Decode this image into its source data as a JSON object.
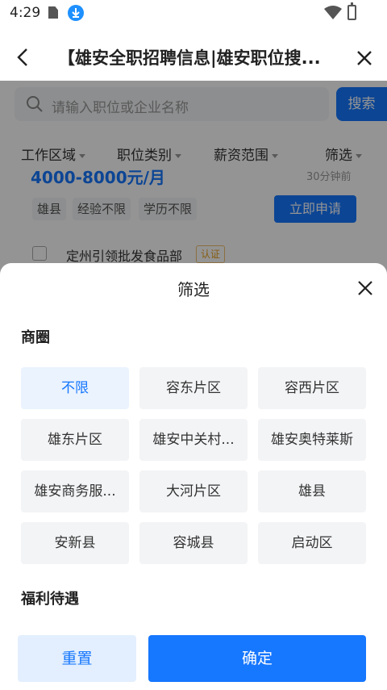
{
  "status_bar": {
    "time": "4:29"
  },
  "title_bar": {
    "title": "【雄安全职招聘信息|雄安职位搜..."
  },
  "background_page": {
    "search": {
      "placeholder": "请输入职位或企业名称",
      "button": "搜索"
    },
    "filters": [
      "工作区域",
      "职位类别",
      "薪资范围",
      "筛选"
    ],
    "job": {
      "salary": "4000-8000元/月",
      "posted": "30分钟前",
      "tags": [
        "雄县",
        "经验不限",
        "学历不限"
      ],
      "apply": "立即申请",
      "company": "定州引领批发食品部",
      "verified": "认证"
    }
  },
  "sheet": {
    "title": "筛选",
    "sections": {
      "business_area": {
        "label": "商圈",
        "options": [
          "不限",
          "容东片区",
          "容西片区",
          "雄东片区",
          "雄安中关村...",
          "雄安奥特莱斯",
          "雄安商务服...",
          "大河片区",
          "雄县",
          "安新县",
          "容城县",
          "启动区"
        ],
        "selected": "不限"
      },
      "welfare": {
        "label": "福利待遇"
      }
    },
    "reset": "重置",
    "confirm": "确定"
  },
  "colors": {
    "accent": "#1677ff",
    "chip_bg": "#f3f4f6",
    "selected_bg": "#eaf3fe"
  }
}
